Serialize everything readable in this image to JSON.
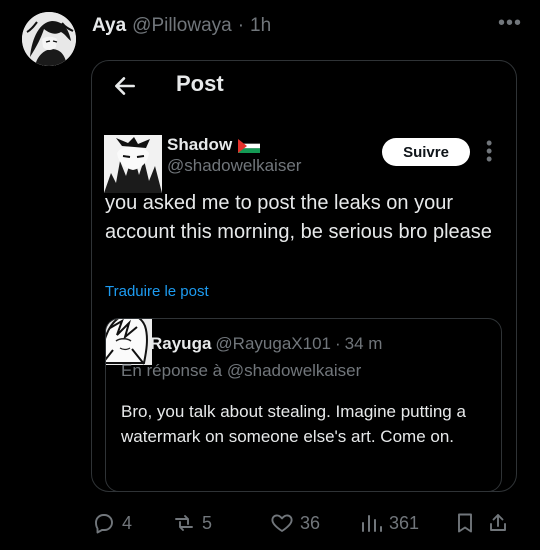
{
  "tweet": {
    "author_name": "Aya",
    "author_handle": "@Pillowaya",
    "separator": "·",
    "time": "1h",
    "more_icon": "more-icon"
  },
  "embed": {
    "title": "Post",
    "back_icon": "arrow-left-icon",
    "quoted": {
      "name": "Shadow",
      "handle": "@shadowelkaiser",
      "follow_label": "Suivre",
      "body": "you asked me to post the leaks on your account this morning, be serious bro please",
      "translate_label": "Traduire le post",
      "more_icon": "vertical-more-icon",
      "flag_icon": "palestine-flag-icon"
    },
    "reply": {
      "name": "Rayuga",
      "handle": "@RayugaX101",
      "separator": "·",
      "time": "34 m",
      "context": "En réponse à @shadowelkaiser",
      "body": "Bro, you talk about stealing. Imagine putting a watermark on someone else's art. Come on."
    }
  },
  "actions": {
    "reply_count": "4",
    "repost_count": "5",
    "like_count": "36",
    "views_count": "361"
  },
  "colors": {
    "background": "#000000",
    "text": "#e7e9ea",
    "muted": "#71767b",
    "link": "#1d9bf0",
    "border": "#2f3336"
  }
}
